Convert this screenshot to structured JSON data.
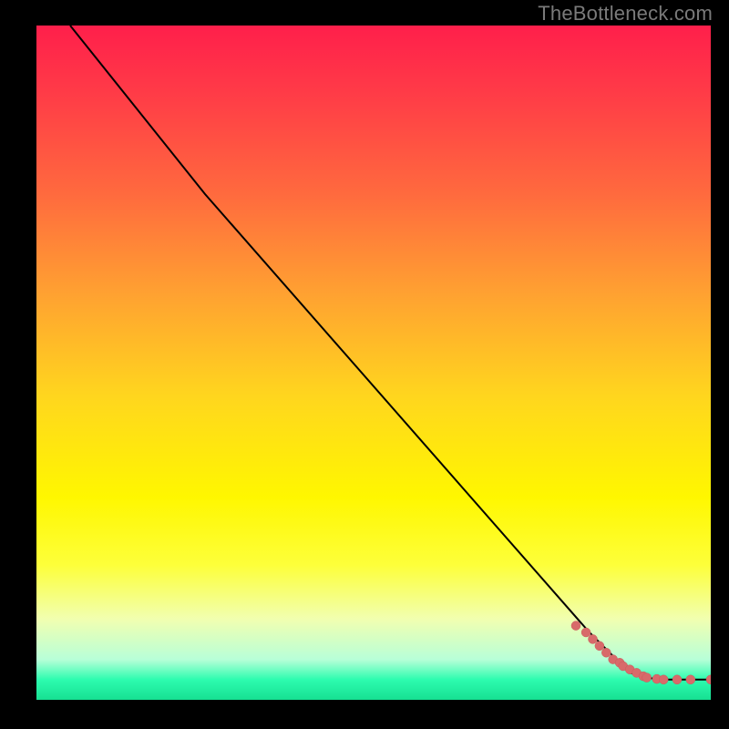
{
  "attribution": "TheBottleneck.com",
  "chart_data": {
    "type": "line",
    "title": "",
    "xlabel": "",
    "ylabel": "",
    "xlim": [
      0,
      100
    ],
    "ylim": [
      0,
      100
    ],
    "grid": false,
    "series": [
      {
        "name": "bottleneck-curve",
        "x": [
          5,
          25,
          82,
          88,
          92,
          95,
          100
        ],
        "y": [
          100,
          75,
          10,
          4,
          3,
          3,
          3
        ]
      }
    ],
    "points": {
      "name": "sample-points",
      "color": "#d86a6a",
      "x": [
        80,
        81.5,
        82.5,
        83.5,
        84.5,
        85.5,
        86.5,
        87,
        88,
        89,
        90,
        90.5,
        92,
        93,
        95,
        97,
        100
      ],
      "y": [
        11,
        10,
        9,
        8,
        7,
        6,
        5.5,
        5,
        4.5,
        4,
        3.5,
        3.3,
        3.1,
        3.0,
        3.0,
        3.0,
        3.0
      ]
    },
    "background_gradient": {
      "top": "#ff1f4b",
      "mid": "#fff700",
      "bottom": "#17e092"
    }
  }
}
